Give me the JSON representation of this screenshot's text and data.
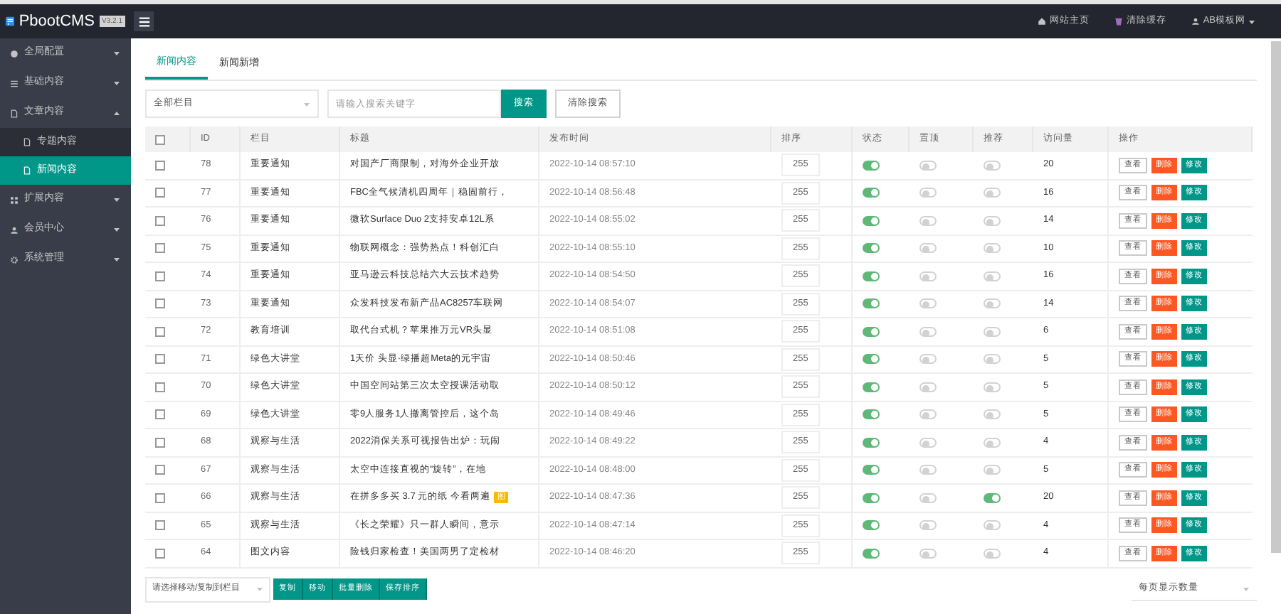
{
  "header": {
    "logo": "PbootCMS",
    "version": "V3.2.1",
    "links": [
      {
        "kind": "home",
        "label": "网站主页"
      },
      {
        "kind": "cache",
        "label": "清除缓存"
      },
      {
        "kind": "user",
        "label": "AB模板网"
      }
    ]
  },
  "sidebar": {
    "items": [
      {
        "label": "全局配置",
        "kind": "globe",
        "expanded": false
      },
      {
        "label": "基础内容",
        "kind": "list",
        "expanded": false
      },
      {
        "label": "文章内容",
        "kind": "file",
        "expanded": true,
        "children": [
          {
            "label": "专题内容",
            "selected": false
          },
          {
            "label": "新闻内容",
            "selected": true
          }
        ]
      },
      {
        "label": "扩展内容",
        "kind": "grid",
        "expanded": false
      },
      {
        "label": "会员中心",
        "kind": "user",
        "expanded": false
      },
      {
        "label": "系统管理",
        "kind": "gear",
        "expanded": false
      }
    ]
  },
  "tabs": [
    {
      "label": "新闻内容",
      "selected": true
    },
    {
      "label": "新闻新增",
      "selected": false
    }
  ],
  "filter": {
    "category": "全部栏目",
    "placeholder": "请输入搜索关键字",
    "search": "搜索",
    "clear": "清除搜索"
  },
  "table": {
    "all_checked": false,
    "columns": [
      "ID",
      "栏目",
      "标题",
      "发布时间",
      "排序",
      "状态",
      "置顶",
      "推荐",
      "访问量",
      "操作"
    ],
    "rows": [
      {
        "checked": false,
        "id": "78",
        "category": "重要通知",
        "title": "对国产厂商限制，对海外企业开放",
        "time": "2022-10-14 08:57:10",
        "sort": "255",
        "status": true,
        "top": false,
        "recommend": false,
        "visits": "20",
        "actions": [
          "查看",
          "删除",
          "修改"
        ]
      },
      {
        "checked": false,
        "id": "77",
        "category": "重要通知",
        "title": "FBC全气候清机四周年｜稳固前行，",
        "time": "2022-10-14 08:56:48",
        "sort": "255",
        "status": true,
        "top": false,
        "recommend": false,
        "visits": "16",
        "actions": [
          "查看",
          "删除",
          "修改"
        ]
      },
      {
        "checked": false,
        "id": "76",
        "category": "重要通知",
        "title": "微软Surface Duo 2支持安卓12L系",
        "time": "2022-10-14 08:55:02",
        "sort": "255",
        "status": true,
        "top": false,
        "recommend": false,
        "visits": "14",
        "actions": [
          "查看",
          "删除",
          "修改"
        ]
      },
      {
        "checked": false,
        "id": "75",
        "category": "重要通知",
        "title": "物联网概念：强势热点！科创汇白",
        "time": "2022-10-14 08:55:10",
        "sort": "255",
        "status": true,
        "top": false,
        "recommend": false,
        "visits": "10",
        "actions": [
          "查看",
          "删除",
          "修改"
        ]
      },
      {
        "checked": false,
        "id": "74",
        "category": "重要通知",
        "title": "亚马逊云科技总结六大云技术趋势",
        "time": "2022-10-14 08:54:50",
        "sort": "255",
        "status": true,
        "top": false,
        "recommend": false,
        "visits": "16",
        "actions": [
          "查看",
          "删除",
          "修改"
        ]
      },
      {
        "checked": false,
        "id": "73",
        "category": "重要通知",
        "title": "众发科技发布新产品AC8257车联网",
        "time": "2022-10-14 08:54:07",
        "sort": "255",
        "status": true,
        "top": false,
        "recommend": false,
        "visits": "14",
        "actions": [
          "查看",
          "删除",
          "修改"
        ]
      },
      {
        "checked": false,
        "id": "72",
        "category": "教育培训",
        "title": "取代台式机？苹果推万元VR头显",
        "time": "2022-10-14 08:51:08",
        "sort": "255",
        "status": true,
        "top": false,
        "recommend": false,
        "visits": "6",
        "actions": [
          "查看",
          "删除",
          "修改"
        ]
      },
      {
        "checked": false,
        "id": "71",
        "category": "绿色大讲堂",
        "title": "1天价 头显·绿播超Meta的元宇宙",
        "time": "2022-10-14 08:50:46",
        "sort": "255",
        "status": true,
        "top": false,
        "recommend": false,
        "visits": "5",
        "actions": [
          "查看",
          "删除",
          "修改"
        ]
      },
      {
        "checked": false,
        "id": "70",
        "category": "绿色大讲堂",
        "title": "中国空间站第三次太空授课活动取",
        "time": "2022-10-14 08:50:12",
        "sort": "255",
        "status": true,
        "top": false,
        "recommend": false,
        "visits": "5",
        "actions": [
          "查看",
          "删除",
          "修改"
        ]
      },
      {
        "checked": false,
        "id": "69",
        "category": "绿色大讲堂",
        "title": "零9人服务1人撤离管控后，这个岛",
        "time": "2022-10-14 08:49:46",
        "sort": "255",
        "status": true,
        "top": false,
        "recommend": false,
        "visits": "5",
        "actions": [
          "查看",
          "删除",
          "修改"
        ]
      },
      {
        "checked": false,
        "id": "68",
        "category": "观察与生活",
        "title": "2022消保关系可视报告出炉：玩闹",
        "time": "2022-10-14 08:49:22",
        "sort": "255",
        "status": true,
        "top": false,
        "recommend": false,
        "visits": "4",
        "actions": [
          "查看",
          "删除",
          "修改"
        ]
      },
      {
        "checked": false,
        "id": "67",
        "category": "观察与生活",
        "title": "太空中连接直视的“旋转”，在地",
        "time": "2022-10-14 08:48:00",
        "sort": "255",
        "status": true,
        "top": false,
        "recommend": false,
        "visits": "5",
        "actions": [
          "查看",
          "删除",
          "修改"
        ]
      },
      {
        "checked": false,
        "id": "66",
        "category": "观察与生活",
        "title": "在拼多多买 3.7 元的纸 今看两遍",
        "badge": "图",
        "time": "2022-10-14 08:47:36",
        "sort": "255",
        "status": true,
        "top": false,
        "recommend": true,
        "visits": "20",
        "actions": [
          "查看",
          "删除",
          "修改"
        ]
      },
      {
        "checked": false,
        "id": "65",
        "category": "观察与生活",
        "title": "《长之荣耀》只一群人瞬间，意示",
        "time": "2022-10-14 08:47:14",
        "sort": "255",
        "status": true,
        "top": false,
        "recommend": false,
        "visits": "4",
        "actions": [
          "查看",
          "删除",
          "修改"
        ]
      },
      {
        "checked": false,
        "id": "64",
        "category": "图文内容",
        "title": "险钱归家检查！美国两男了定检材",
        "time": "2022-10-14 08:46:20",
        "sort": "255",
        "status": true,
        "top": false,
        "recommend": false,
        "visits": "4",
        "actions": [
          "查看",
          "删除",
          "修改"
        ]
      }
    ]
  },
  "bulk": {
    "target": "请选择移动/复制到栏目",
    "buttons": [
      "复制",
      "移动",
      "批量删除",
      "保存排序"
    ]
  },
  "page_size": {
    "placeholder": "每页显示数量"
  }
}
